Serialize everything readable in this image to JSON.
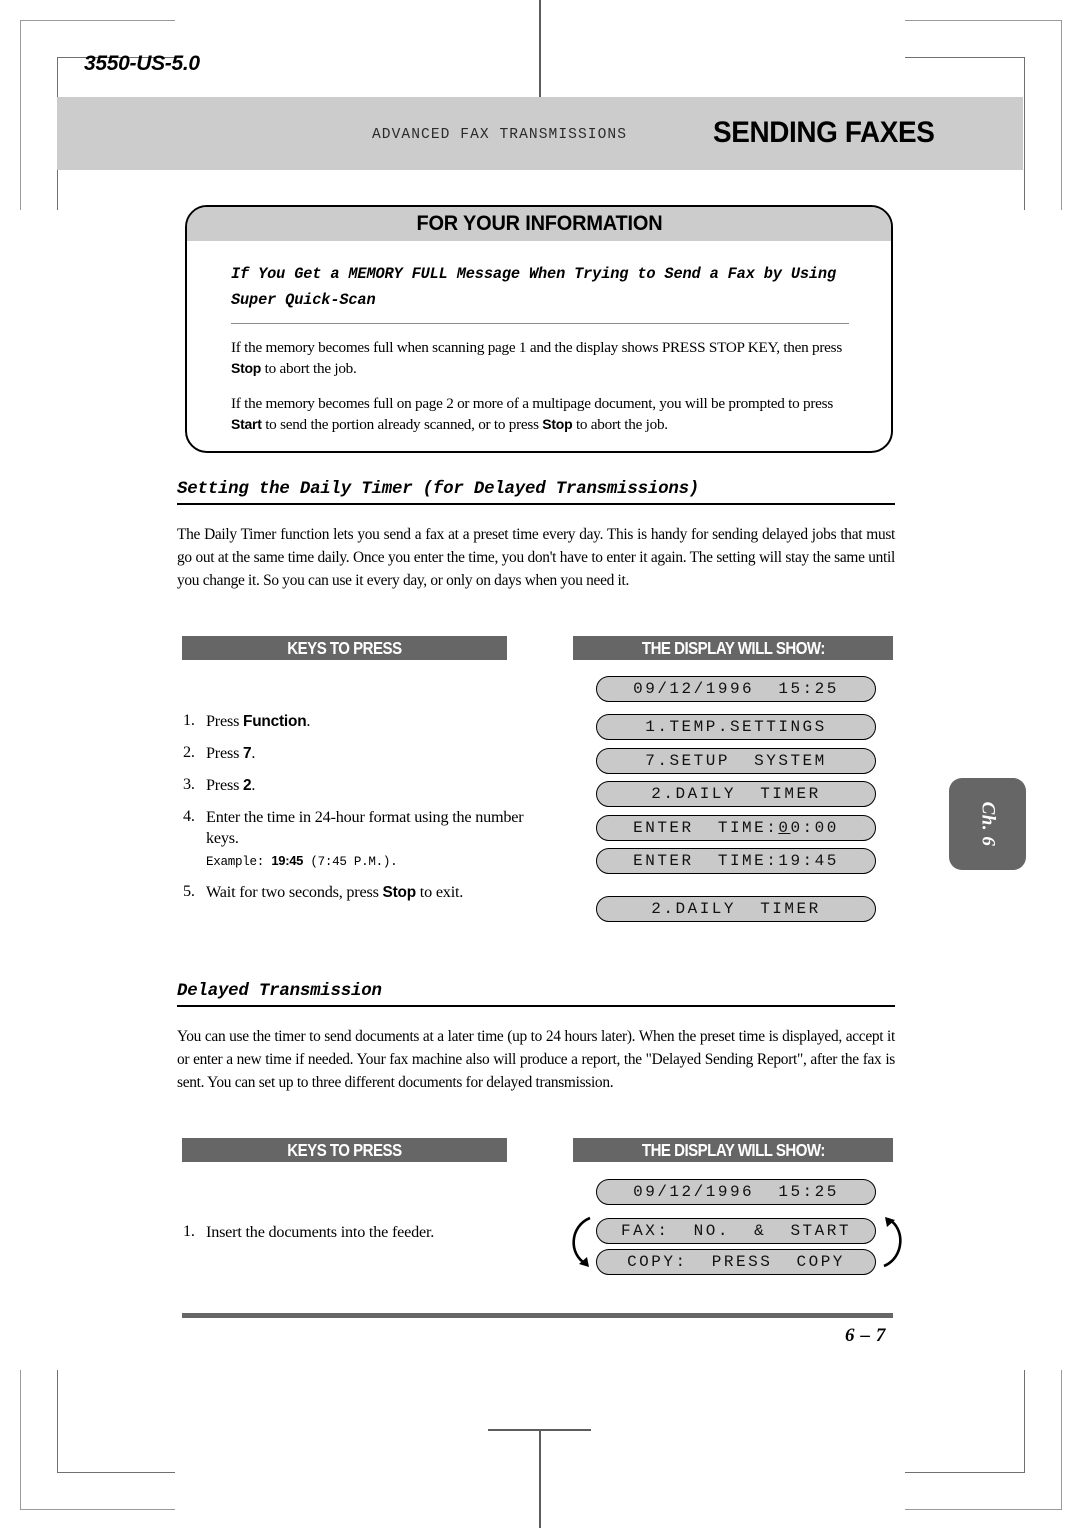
{
  "doc_code": "3550-US-5.0",
  "header": {
    "kicker": "ADVANCED FAX TRANSMISSIONS",
    "title": "SENDING FAXES"
  },
  "fyi": {
    "heading": "FOR YOUR INFORMATION",
    "subheading": "If You Get a MEMORY FULL Message When Trying to Send a Fax by Using Super Quick-Scan",
    "paragraph_1_a": "If the memory becomes full when scanning page 1 and the display shows PRESS STOP KEY, then press ",
    "paragraph_1_b": "Stop",
    "paragraph_1_c": " to abort the job.",
    "paragraph_2_a": "If the memory becomes full on page 2 or more of a multipage document, you will be prompted to press ",
    "paragraph_2_b": "Start",
    "paragraph_2_c": " to send the portion already scanned, or to press ",
    "paragraph_2_d": "Stop",
    "paragraph_2_e": " to abort the job."
  },
  "section_daily_timer": {
    "title": "Setting the Daily Timer (for Delayed Transmissions)",
    "body": "The Daily Timer function lets you send a fax at a preset time every day. This is handy for sending delayed jobs that must go out at the same time daily. Once you enter the time, you don't have to enter it again. The setting will stay the same until you change it. So you can use it every day, or only on days when you need it.",
    "keys_header": "KEYS TO PRESS",
    "display_header": "THE DISPLAY WILL SHOW:",
    "steps": [
      {
        "n": "1.",
        "pre": "Press ",
        "key": "Function",
        "post": "."
      },
      {
        "n": "2.",
        "pre": "Press ",
        "key": "7",
        "post": "."
      },
      {
        "n": "3.",
        "pre": "Press ",
        "key": "2",
        "post": "."
      },
      {
        "n": "4.",
        "pre": "Enter the time in 24-hour format using the number keys.",
        "key": "",
        "post": "",
        "example_pre": "Example: ",
        "example_key": "19:45",
        "example_post": " (7:45 P.M.)."
      },
      {
        "n": "5.",
        "pre": "Wait for two seconds, press ",
        "key": "Stop",
        "post": " to exit."
      }
    ],
    "displays": [
      {
        "text": "09/12/1996  15:25",
        "cursor": ""
      },
      {
        "text": "1.TEMP.SETTINGS",
        "cursor": ""
      },
      {
        "text": "7.SETUP  SYSTEM",
        "cursor": ""
      },
      {
        "text": "2.DAILY  TIMER",
        "cursor": ""
      },
      {
        "text_before": "ENTER  TIME:",
        "cursor": "0",
        "text_after": "0:00"
      },
      {
        "text": "ENTER  TIME:19:45",
        "cursor": ""
      },
      {
        "text": "2.DAILY  TIMER",
        "cursor": ""
      }
    ]
  },
  "section_delayed": {
    "title": "Delayed Transmission",
    "body": "You can use the timer to send documents at a later time (up to 24 hours later). When the preset time is displayed, accept it or enter a new time if needed. Your fax machine also will produce a report, the \"Delayed Sending Report\", after the fax is sent. You can set up to three different documents for delayed transmission.",
    "keys_header": "KEYS TO PRESS",
    "display_header": "THE DISPLAY WILL SHOW:",
    "steps": [
      {
        "n": "1.",
        "pre": "Insert the documents into the feeder.",
        "key": "",
        "post": ""
      }
    ],
    "displays": [
      {
        "text": "09/12/1996  15:25"
      },
      {
        "text": "FAX:  NO.  &  START"
      },
      {
        "text": "COPY:  PRESS  COPY"
      }
    ]
  },
  "chapter_tab": "Ch. 6",
  "page_number": "6 – 7",
  "colors": {
    "header_band": "#cccccc",
    "bar_dark": "#666666",
    "lcd_fill": "#c9c9c9"
  }
}
